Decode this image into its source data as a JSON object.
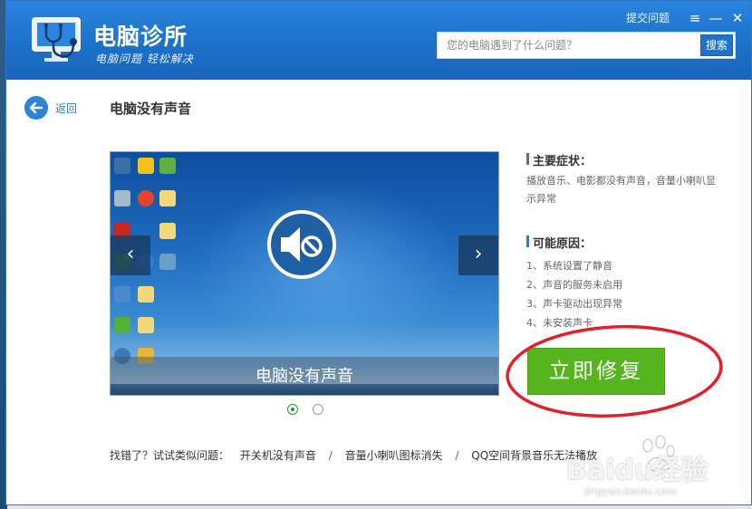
{
  "header": {
    "app_title": "电脑诊所",
    "slogan": "电脑问题 轻松解决",
    "report_link": "提交问题",
    "search_placeholder": "您的电脑遇到了什么问题？",
    "search_button": "搜索",
    "menu_icon": "≡",
    "min_icon": "—",
    "close_icon": "✕"
  },
  "nav": {
    "back_label": "返回"
  },
  "page": {
    "title": "电脑没有声音"
  },
  "slide": {
    "caption": "电脑没有声音",
    "prev": "‹",
    "next": "›",
    "active_index": 1,
    "count": 2
  },
  "info": {
    "symptoms_heading": "主要症状：",
    "symptoms_text": "播放音乐、电影都没有声音，音量小喇叭显示异常",
    "causes_heading": "可能原因：",
    "causes": [
      "1、系统设置了静音",
      "2、声音的服务未启用",
      "3、声卡驱动出现异常",
      "4、未安装声卡"
    ]
  },
  "fix_button": "立即修复",
  "related": {
    "lead": "找错了？试试类似问题：",
    "items": [
      "开关机没有声音",
      "音量小喇叭图标消失",
      "QQ空间背景音乐无法播放"
    ],
    "separator": "/"
  },
  "watermark": {
    "text": "Baidu经验",
    "url": "jingyan.baidu.com"
  },
  "colors": {
    "header_blue": "#1c70c8",
    "fix_green": "#56b51f",
    "annotation_red": "#e0202a"
  }
}
